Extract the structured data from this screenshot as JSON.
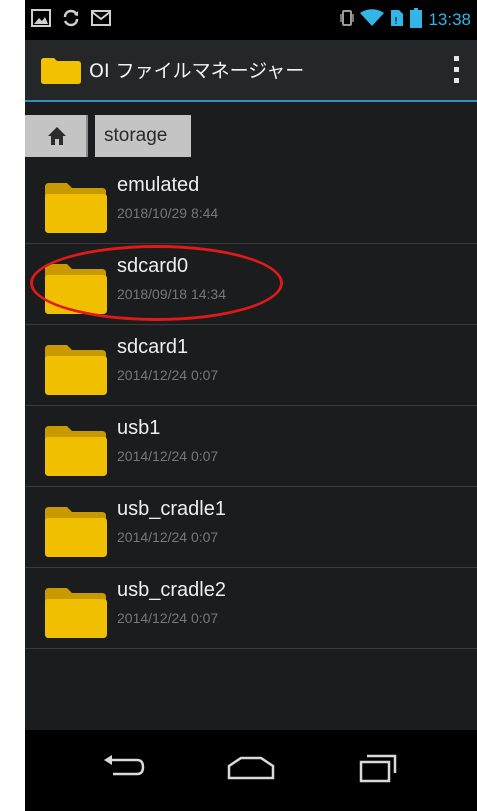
{
  "status_bar": {
    "clock": "13:38",
    "left_icons": [
      "image-icon",
      "sync-icon",
      "mail-icon"
    ],
    "right_icons": [
      "vibrate-icon",
      "wifi-icon",
      "no-sim-icon",
      "battery-icon"
    ],
    "accent_color": "#33b5e5"
  },
  "action_bar": {
    "title": "OI ファイルマネージャー",
    "app_icon": "folder-icon",
    "menu_icon": "overflow-menu-icon",
    "underline_color": "#2b90c0"
  },
  "path_bar": {
    "home_icon": "home-icon",
    "crumbs": [
      "storage"
    ]
  },
  "files": [
    {
      "name": "emulated",
      "date": "2018/10/29 8:44"
    },
    {
      "name": "sdcard0",
      "date": "2018/09/18 14:34"
    },
    {
      "name": "sdcard1",
      "date": "2014/12/24 0:07"
    },
    {
      "name": "usb1",
      "date": "2014/12/24 0:07"
    },
    {
      "name": "usb_cradle1",
      "date": "2014/12/24 0:07"
    },
    {
      "name": "usb_cradle2",
      "date": "2014/12/24 0:07"
    }
  ],
  "annotation": {
    "highlighted_item": "sdcard0",
    "color": "#e01919"
  },
  "nav_bar": {
    "buttons": [
      "back-icon",
      "home-nav-icon",
      "recents-icon"
    ]
  }
}
